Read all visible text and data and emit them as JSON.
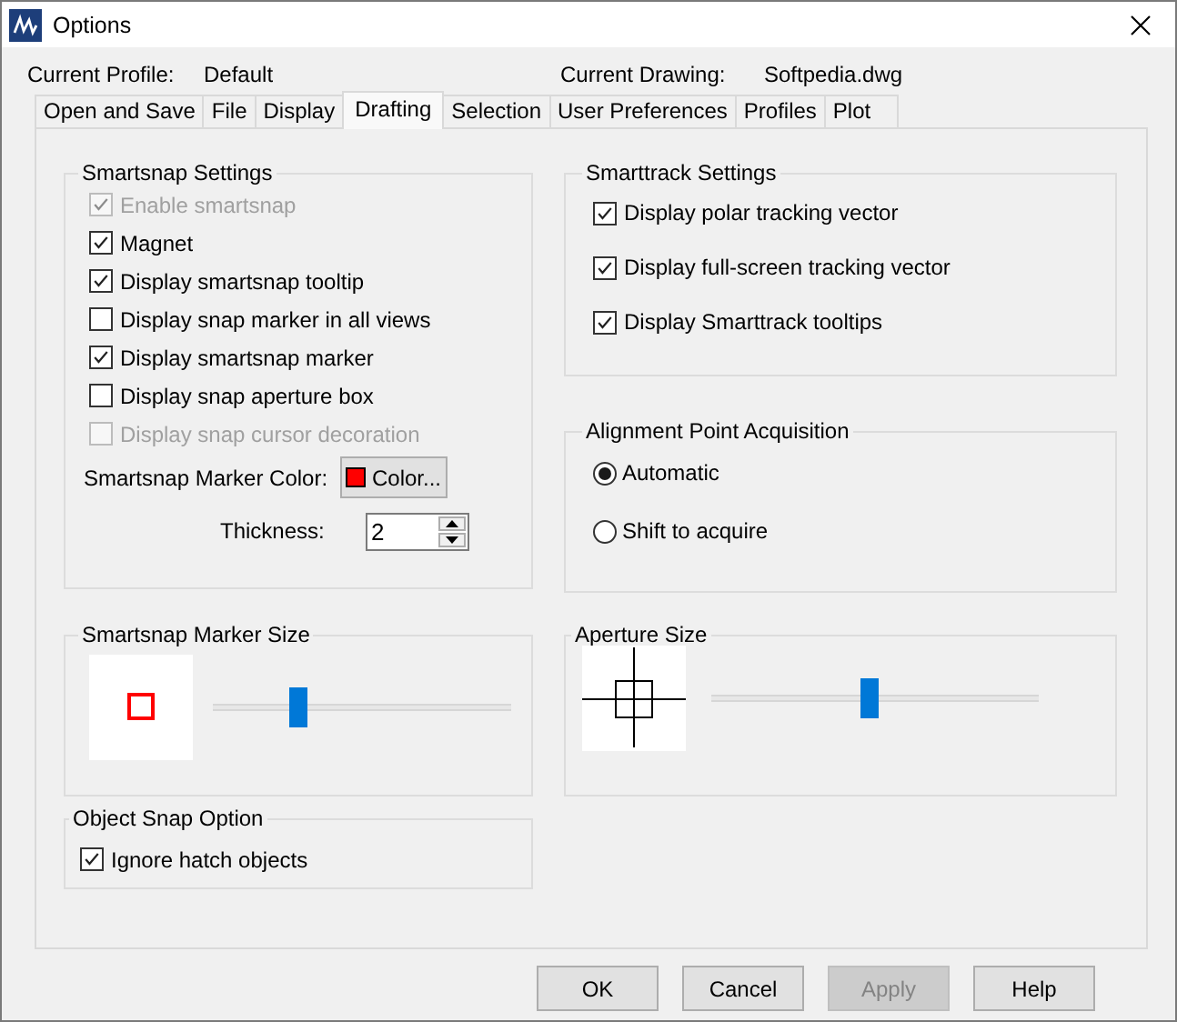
{
  "window": {
    "title": "Options"
  },
  "header": {
    "profile_label": "Current Profile:",
    "profile": "Default",
    "drawing_label": "Current Drawing:",
    "drawing": "Softpedia.dwg"
  },
  "tabs": [
    {
      "label": "Open and Save",
      "selected": false
    },
    {
      "label": "File",
      "selected": false
    },
    {
      "label": "Display",
      "selected": false
    },
    {
      "label": "Drafting",
      "selected": true
    },
    {
      "label": "Selection",
      "selected": false
    },
    {
      "label": "User Preferences",
      "selected": false
    },
    {
      "label": "Profiles",
      "selected": false
    },
    {
      "label": "Plot",
      "selected": false
    }
  ],
  "smartsnap": {
    "title": "Smartsnap Settings",
    "options": [
      {
        "label": "Enable smartsnap",
        "checked": true,
        "disabled": true
      },
      {
        "label": "Magnet",
        "checked": true,
        "disabled": false
      },
      {
        "label": "Display smartsnap tooltip",
        "checked": true,
        "disabled": false
      },
      {
        "label": "Display snap marker in all views",
        "checked": false,
        "disabled": false
      },
      {
        "label": "Display smartsnap marker",
        "checked": true,
        "disabled": false
      },
      {
        "label": "Display snap aperture box",
        "checked": false,
        "disabled": false
      },
      {
        "label": "Display snap cursor decoration",
        "checked": false,
        "disabled": true
      }
    ],
    "color_label": "Smartsnap Marker Color:",
    "color_button": "Color...",
    "thickness_label": "Thickness:",
    "thickness": "2"
  },
  "smarttrack": {
    "title": "Smarttrack Settings",
    "options": [
      {
        "label": "Display polar tracking vector",
        "checked": true
      },
      {
        "label": "Display full-screen tracking vector",
        "checked": true
      },
      {
        "label": "Display Smarttrack tooltips",
        "checked": true
      }
    ]
  },
  "alignment": {
    "title": "Alignment Point Acquisition",
    "options": [
      {
        "label": "Automatic",
        "selected": true
      },
      {
        "label": "Shift to acquire",
        "selected": false
      }
    ]
  },
  "marker_size": {
    "title": "Smartsnap Marker Size",
    "level": 0.27
  },
  "aperture_size": {
    "title": "Aperture Size",
    "level": 0.48
  },
  "object_snap": {
    "title": "Object Snap Option",
    "options": [
      {
        "label": "Ignore hatch objects",
        "checked": true
      }
    ]
  },
  "buttons": [
    {
      "label": "OK",
      "disabled": false
    },
    {
      "label": "Cancel",
      "disabled": false
    },
    {
      "label": "Apply",
      "disabled": true
    },
    {
      "label": "Help",
      "disabled": false
    }
  ]
}
